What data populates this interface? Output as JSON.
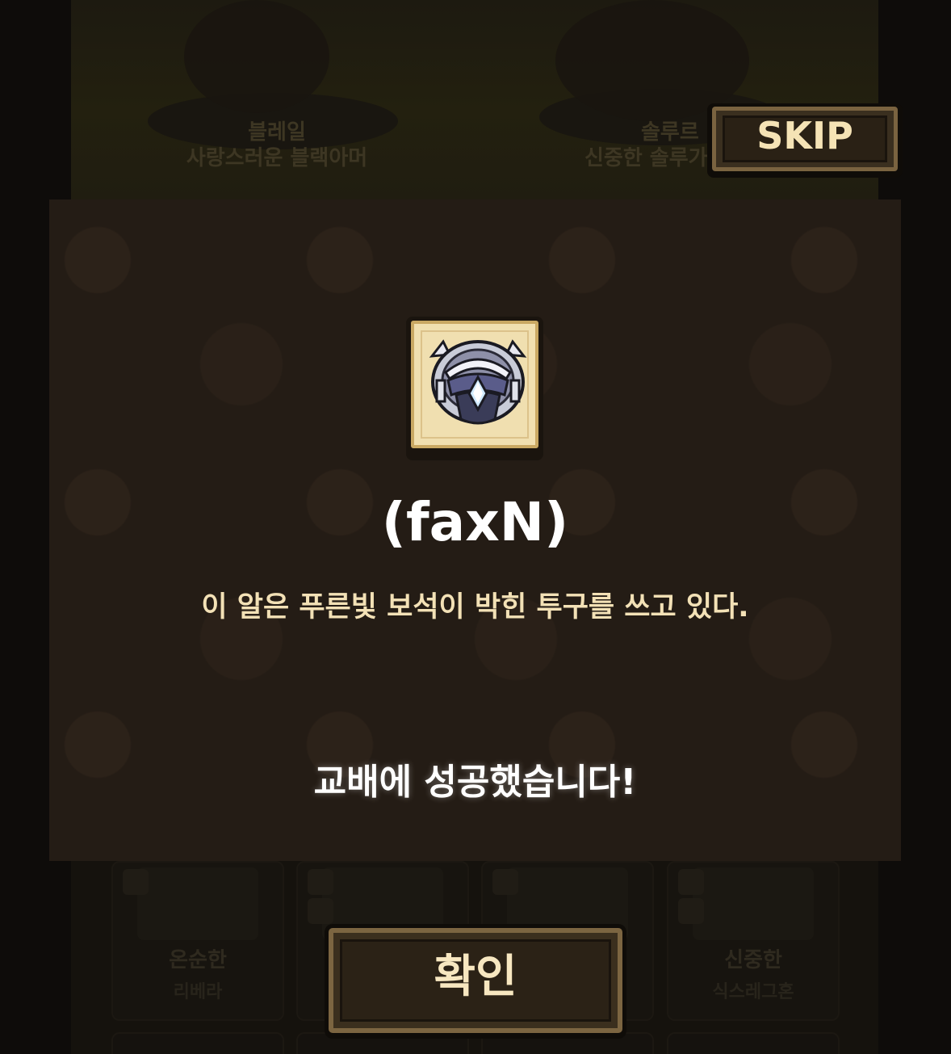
{
  "background": {
    "creatures": [
      {
        "title": "블레일",
        "subtitle": "사랑스러운 블랙아머"
      },
      {
        "title": "솔루르",
        "subtitle": "신중한 솔루가"
      }
    ],
    "cards": [
      {
        "title": "온순한",
        "subtitle": "리베라"
      },
      {
        "title": "",
        "subtitle": ""
      },
      {
        "title": "",
        "subtitle": ""
      },
      {
        "title": "신중한",
        "subtitle": "식스레그혼"
      }
    ]
  },
  "skip_button": {
    "label": "SKIP"
  },
  "modal": {
    "item_icon": "blue-gem-helmet-icon",
    "item_title": "(faxN)",
    "item_description": "이 알은 푸른빛 보석이 박힌 투구를 쓰고 있다.",
    "success_message": "교배에 성공했습니다!"
  },
  "confirm_button": {
    "label": "확인"
  },
  "colors": {
    "modal_bg": "#241c15",
    "frame_parchment": "#f0dfb0",
    "button_face": "#2b2216",
    "button_border": "#7c6541",
    "text_cream": "#f3e1b6"
  }
}
